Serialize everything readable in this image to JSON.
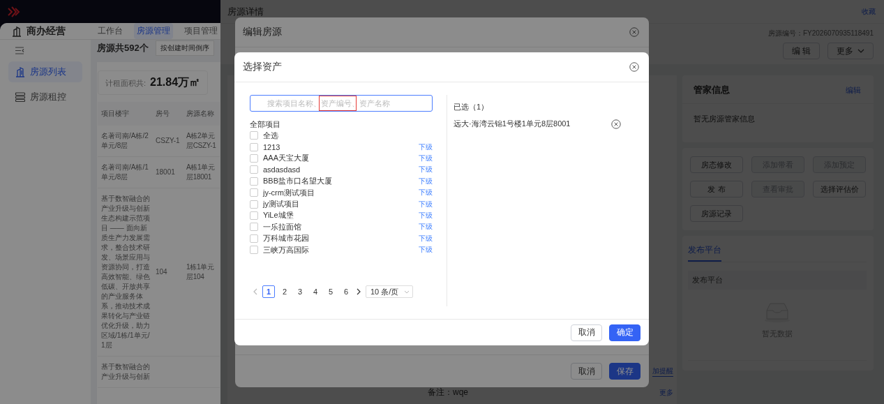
{
  "app": {
    "module": "商办经营",
    "nav_tabs": [
      {
        "label": "工作台",
        "selected": false
      },
      {
        "label": "房源管理",
        "selected": true
      },
      {
        "label": "项目管理",
        "selected": false
      }
    ],
    "sidebar": {
      "items": [
        {
          "label": "房源列表",
          "kind": "list",
          "selected": true
        },
        {
          "label": "房源租控",
          "kind": "grid",
          "selected": false
        }
      ]
    },
    "toolbar": {
      "total": "房源共592个",
      "sort": "按创建时间倒序"
    },
    "stats": {
      "label": "计租面积共:",
      "value": "21.84万㎡"
    },
    "table": {
      "columns": [
        "项目楼宇",
        "房号",
        "房源名称"
      ],
      "rows": [
        {
          "building": "名著司南/A栋/2单元/8层",
          "room": "CSZY-1",
          "name_lines": [
            "A栋2单元",
            "层CSZY-1"
          ]
        },
        {
          "building": "名著司南/A栋/1单元/8层",
          "room": "18001",
          "name_lines": [
            "A栋1单元",
            "层18001"
          ]
        },
        {
          "building": "基于数智融合的产业升级与创新生态构建示范项目 —— 面向新质生产力发展需求，整合技术研发、场景应用与资源协同，打造高效智能、绿色低碳、开放共享的产业服务体系，推动技术成果转化与产业链优化升级，助力区域/1栋/1单元/1层",
          "room": "104",
          "name_lines": [
            "1栋1单元",
            "层104"
          ]
        },
        {
          "building": "基于数智融合的产业升级与创新",
          "room": "",
          "name_lines": []
        }
      ]
    }
  },
  "drawer": {
    "title": "房源详情",
    "favorite": "收藏",
    "code": "房源编号：FY2026070935118491",
    "buttons": [
      {
        "label": "编 辑",
        "kind": "plain"
      },
      {
        "label": "更多",
        "kind": "dropdown"
      }
    ],
    "steward": {
      "title": "管家信息",
      "edit": "编辑",
      "empty": "暂无房源管家信息"
    },
    "actions": [
      {
        "label": "房态修改",
        "disabled": false
      },
      {
        "label": "添加带看",
        "disabled": true
      },
      {
        "label": "添加预定",
        "disabled": true
      },
      {
        "label": "发 布",
        "disabled": false
      },
      {
        "label": "查看审批",
        "disabled": true
      },
      {
        "label": "选择评估价",
        "disabled": false
      },
      {
        "label": "房源记录",
        "disabled": false
      }
    ],
    "publish": {
      "tabs": [
        {
          "label": "发布平台",
          "selected": true
        }
      ],
      "columns": [
        "发布平台"
      ],
      "empty": "暂无数据"
    },
    "notes": {
      "remind": "加提醒",
      "remark": "备注：wqe",
      "more": "更多"
    }
  },
  "edit_modal": {
    "title": "编辑房源",
    "buttons": [
      {
        "label": "取消",
        "primary": false
      },
      {
        "label": "保存",
        "primary": true
      }
    ]
  },
  "asset_modal": {
    "title": "选择资产",
    "search": {
      "placeholder": "搜索项目名称、资产编号、资产名称"
    },
    "tree_label": "全部项目",
    "select_all": {
      "label": "全选",
      "checked": false
    },
    "items": [
      {
        "label": "1213",
        "checked": false,
        "link": "下级"
      },
      {
        "label": "AAA天宝大厦",
        "checked": false,
        "link": "下级"
      },
      {
        "label": "asdasdasd",
        "checked": false,
        "link": "下级"
      },
      {
        "label": "BBB盐市口名望大厦",
        "checked": false,
        "link": "下级"
      },
      {
        "label": "jy-crm测试项目",
        "checked": false,
        "link": "下级"
      },
      {
        "label": "jy测试项目",
        "checked": false,
        "link": "下级"
      },
      {
        "label": "YiLe城堡",
        "checked": false,
        "link": "下级"
      },
      {
        "label": "一乐拉面馆",
        "checked": false,
        "link": "下级"
      },
      {
        "label": "万科城市花园",
        "checked": false,
        "link": "下级"
      },
      {
        "label": "三峡万高国际",
        "checked": false,
        "link": "下级"
      }
    ],
    "pagination": {
      "pages": [
        {
          "label": "1",
          "selected": true
        },
        {
          "label": "2",
          "selected": false
        },
        {
          "label": "3",
          "selected": false
        },
        {
          "label": "4",
          "selected": false
        },
        {
          "label": "5",
          "selected": false
        },
        {
          "label": "6",
          "selected": false
        }
      ],
      "page_size": "10 条/页"
    },
    "selected": {
      "title": "已选（1）",
      "items": [
        "远大·海湾云锦1号楼1单元8层8001"
      ]
    },
    "buttons": [
      {
        "label": "取消",
        "primary": false
      },
      {
        "label": "确定",
        "primary": true
      }
    ]
  }
}
